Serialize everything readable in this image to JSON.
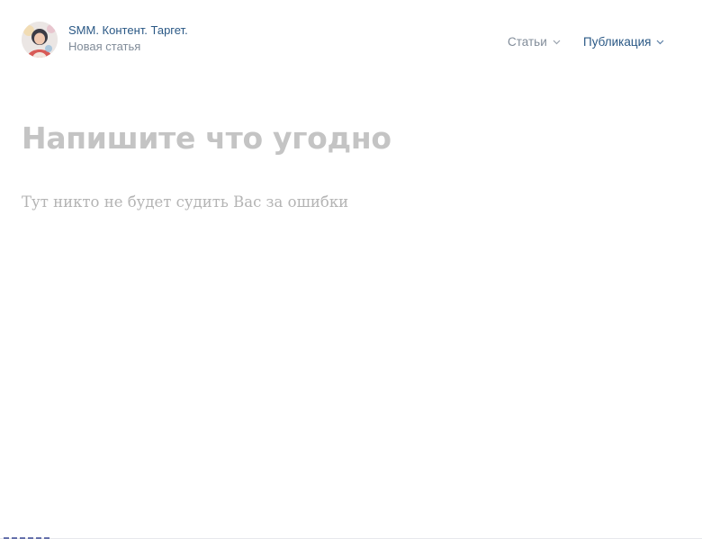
{
  "header": {
    "group_name": "SMM. Контент. Таргет.",
    "article_status": "Новая статья",
    "avatar_icon": "community-avatar",
    "nav": {
      "articles_label": "Статьи",
      "publish_label": "Публикация"
    }
  },
  "editor": {
    "title_placeholder": "Напишите что угодно",
    "body_placeholder": "Тут никто не будет судить Вас за ошибки"
  },
  "colors": {
    "link": "#2a5885",
    "secondary": "#818c99",
    "placeholder_title": "#c4c4c4",
    "placeholder_body": "#b4b4b4"
  }
}
